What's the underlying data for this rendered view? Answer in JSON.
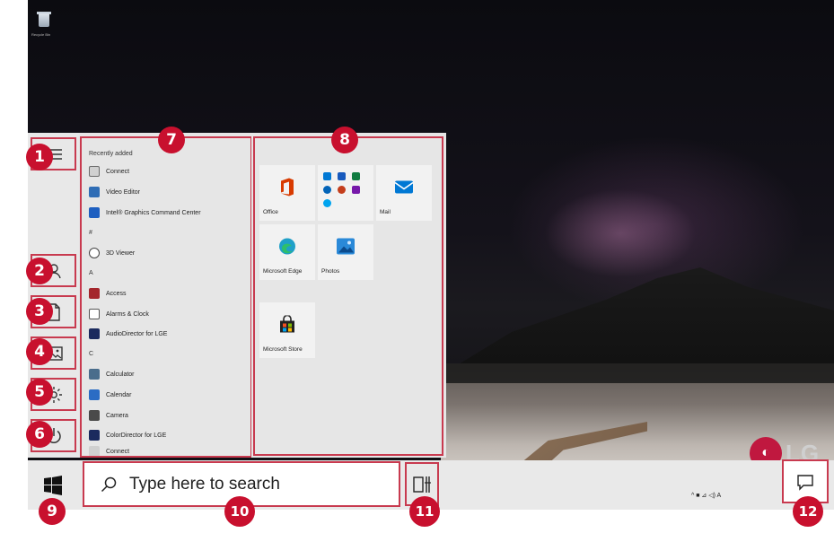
{
  "desktop": {
    "recycle_bin_label": "Recycle Bin",
    "brand_logo": "LG"
  },
  "start_menu": {
    "rail_icons": [
      "hamburger-menu-icon",
      "user-icon",
      "document-icon",
      "pictures-icon",
      "settings-gear-icon",
      "power-icon"
    ],
    "app_list": {
      "recently_added_header": "Recently added",
      "items": [
        {
          "label": "Connect",
          "icon": "connect-icon",
          "color": "#6b6b6b"
        },
        {
          "label": "Video Editor",
          "icon": "video-editor-icon",
          "color": "#2f6db5"
        },
        {
          "label": "Intel® Graphics Command Center",
          "icon": "intel-graphics-icon",
          "color": "#1e5fc0"
        },
        {
          "label": "#",
          "header": true
        },
        {
          "label": "3D Viewer",
          "icon": "3d-viewer-icon",
          "color": "#444444"
        },
        {
          "label": "A",
          "header": true
        },
        {
          "label": "Access",
          "icon": "access-icon",
          "color": "#a4262c"
        },
        {
          "label": "Alarms & Clock",
          "icon": "alarms-clock-icon",
          "color": "#555555"
        },
        {
          "label": "AudioDirector for LGE",
          "icon": "audiodirector-icon",
          "color": "#1b2a5e"
        },
        {
          "label": "C",
          "header": true
        },
        {
          "label": "Calculator",
          "icon": "calculator-icon",
          "color": "#4a6d8c"
        },
        {
          "label": "Calendar",
          "icon": "calendar-icon",
          "color": "#2b6cc4"
        },
        {
          "label": "Camera",
          "icon": "camera-icon",
          "color": "#4a4a4a"
        },
        {
          "label": "ColorDirector for LGE",
          "icon": "colordirector-icon",
          "color": "#1b2a5e"
        },
        {
          "label": "Connect",
          "icon": "connect-icon",
          "color": "#6b6b6b"
        }
      ]
    },
    "tiles": [
      {
        "label": "Office",
        "icon": "office-icon"
      },
      {
        "label": "",
        "icon": "office-apps-group-icon"
      },
      {
        "label": "Mail",
        "icon": "mail-icon"
      },
      {
        "label": "Microsoft Edge",
        "icon": "edge-icon"
      },
      {
        "label": "Photos",
        "icon": "photos-icon"
      },
      {
        "label": "Microsoft Store",
        "icon": "store-icon"
      }
    ]
  },
  "taskbar": {
    "search_placeholder": "Type here to search",
    "tray_text": "^ ■ ⊿ ◁) A"
  },
  "callouts": [
    "1",
    "2",
    "3",
    "4",
    "5",
    "6",
    "7",
    "8",
    "9",
    "10",
    "11",
    "12"
  ],
  "colors": {
    "callout": "#c8102e",
    "highlight_border": "#c83a4f",
    "start_bg": "#e6e6e6"
  }
}
